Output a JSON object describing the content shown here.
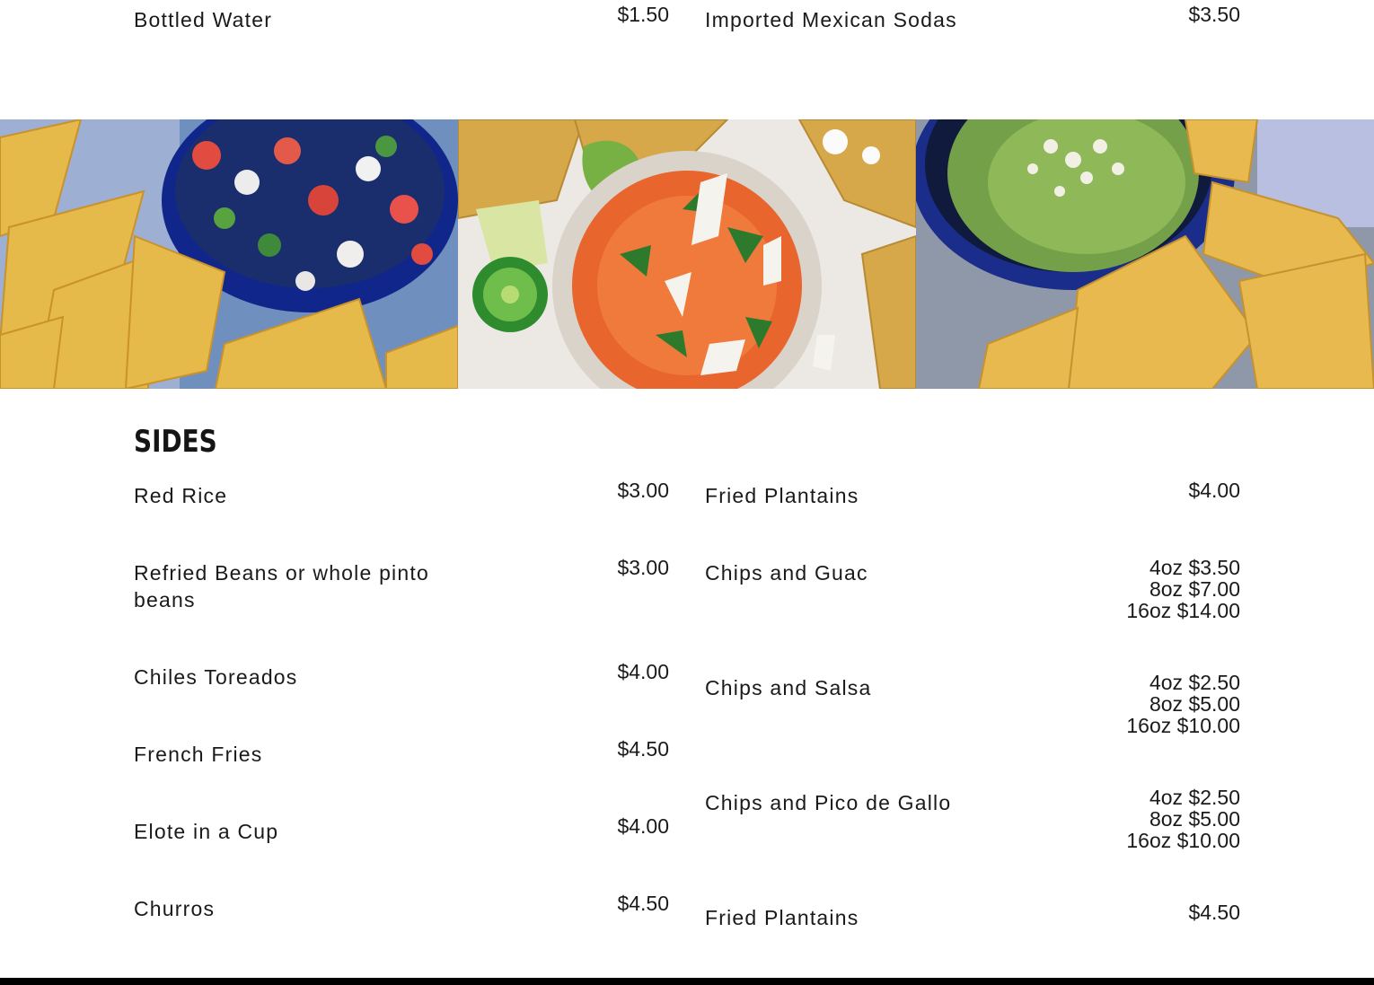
{
  "drinks": {
    "left": {
      "name": "Bottled Water",
      "prices": [
        "$1.50"
      ]
    },
    "right": {
      "name": "Imported Mexican Sodas",
      "prices": [
        "$3.50"
      ]
    }
  },
  "banner": {
    "photos": [
      {
        "subject": "chips-and-pico-de-gallo-photo"
      },
      {
        "subject": "chips-and-salsa-photo"
      },
      {
        "subject": "chips-and-guacamole-photo"
      }
    ]
  },
  "sides": {
    "title": "SIDES",
    "left_items": [
      {
        "name": "Red Rice",
        "prices": [
          "$3.00"
        ]
      },
      {
        "name": "Refried Beans or whole pinto beans",
        "prices": [
          "$3.00"
        ]
      },
      {
        "name": "Chiles Toreados",
        "prices": [
          "$4.00"
        ]
      },
      {
        "name": "French Fries",
        "prices": [
          "$4.50"
        ]
      },
      {
        "name": "Elote in a Cup",
        "prices": [
          "$4.00"
        ]
      },
      {
        "name": "Churros",
        "prices": [
          "$4.50"
        ]
      }
    ],
    "right_items": [
      {
        "name": "Fried Plantains",
        "prices": [
          "$4.00"
        ]
      },
      {
        "name": "Chips and Guac",
        "prices": [
          "4oz $3.50",
          "8oz $7.00",
          "16oz $14.00"
        ]
      },
      {
        "name": "Chips and Salsa",
        "prices": [
          "4oz $2.50",
          "8oz $5.00",
          "16oz $10.00"
        ]
      },
      {
        "name": "Chips and Pico de Gallo",
        "prices": [
          "4oz $2.50",
          "8oz $5.00",
          "16oz $10.00"
        ]
      },
      {
        "name": "Fried Plantains",
        "prices": [
          "$4.50"
        ]
      }
    ]
  },
  "colors": {
    "text": "#1a1a1a",
    "background": "#ffffff",
    "footer": "#000000"
  }
}
